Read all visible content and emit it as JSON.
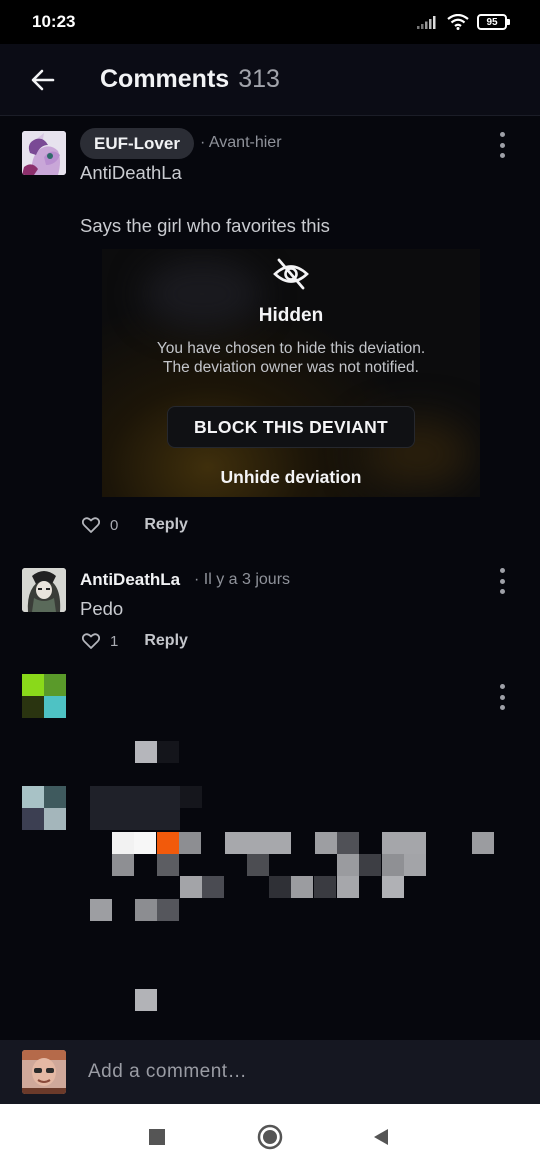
{
  "status_bar": {
    "time": "10:23",
    "battery": "95"
  },
  "header": {
    "title": "Comments",
    "count": "313"
  },
  "comments": [
    {
      "author": "EUF-Lover",
      "timestamp": "· Avant-hier",
      "reply_to": "AntiDeathLa",
      "text": "Says the girl who favorites this",
      "hidden_card": {
        "title": "Hidden",
        "line1": "You have chosen to hide this deviation.",
        "line2": "The deviation owner was not notified.",
        "block_label": "BLOCK THIS DEVIANT",
        "unhide_label": "Unhide deviation"
      },
      "likes": "0",
      "reply_label": "Reply"
    },
    {
      "author": "AntiDeathLa",
      "timestamp": "· Il y a 3 jours",
      "text": "Pedo",
      "likes": "1",
      "reply_label": "Reply"
    }
  ],
  "composer": {
    "placeholder": "Add a comment…"
  },
  "icons": {
    "back": "arrow-left-icon",
    "more": "more-vertical-icon",
    "like": "heart-outline-icon",
    "hidden": "eye-off-icon",
    "nav_recents": "square-icon",
    "nav_home": "circle-icon",
    "nav_back": "triangle-back-icon"
  },
  "colors": {
    "background": "#06070d",
    "header": "#0b0c15",
    "pill": "#2b2d35",
    "composer": "#151721"
  }
}
